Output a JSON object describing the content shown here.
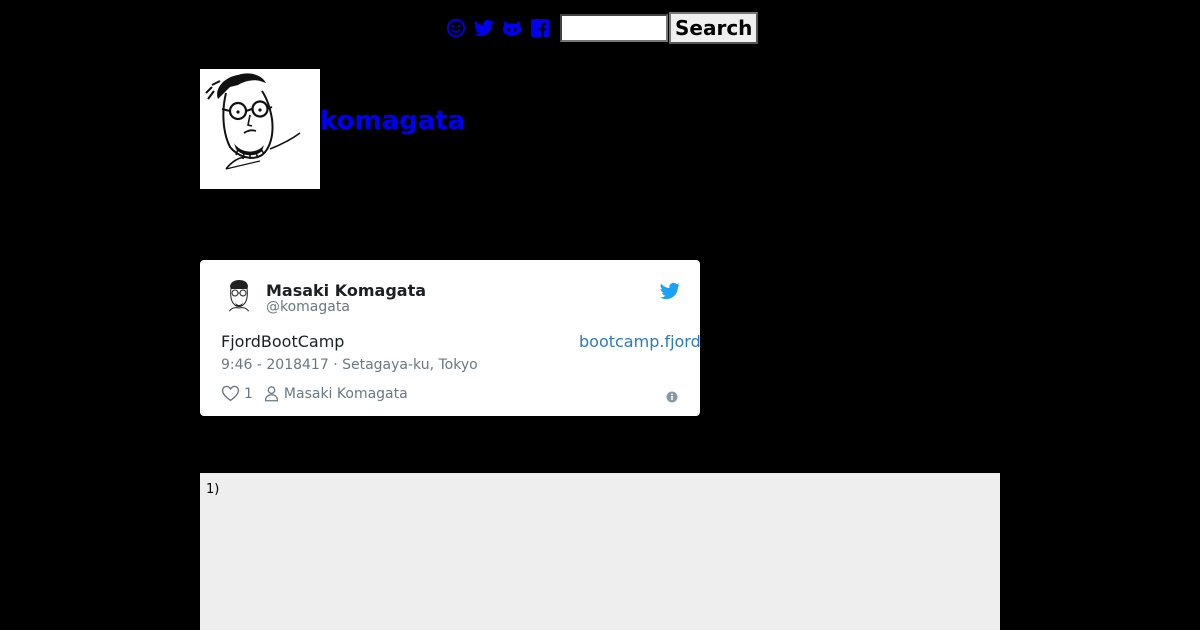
{
  "nav": {
    "icons": [
      "smiley-icon",
      "twitter-icon",
      "github-icon",
      "facebook-icon"
    ],
    "search_placeholder": "",
    "search_button_label": "Search"
  },
  "header": {
    "site_title": "komagata"
  },
  "tweet": {
    "author_name": "Masaki Komagata",
    "author_handle": "@komagata",
    "text": "FjordBootCamp",
    "link_text": "bootcamp.fjord",
    "meta": "9:46 - 2018417 · Setagaya-ku, Tokyo",
    "like_count": "1",
    "footer_author": "Masaki Komagata",
    "colors": {
      "link": "#2b7bb9",
      "bird": "#1da1f2",
      "muted": "#697882"
    }
  },
  "footnote": {
    "label": "1)"
  },
  "colors": {
    "page_background": "#000000",
    "link_blue": "#0000ee",
    "footnote_background": "#eeeeee"
  }
}
